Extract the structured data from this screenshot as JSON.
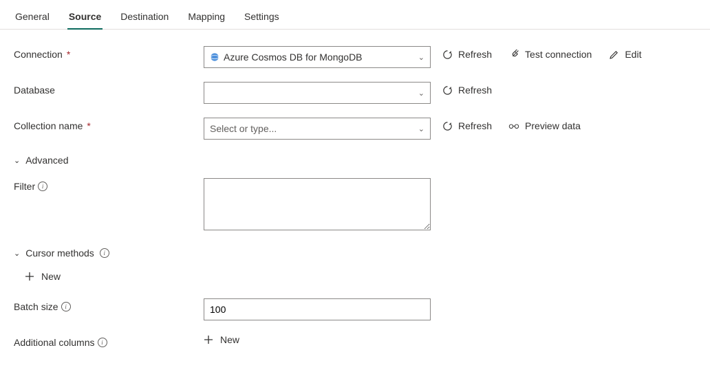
{
  "tabs": {
    "general": "General",
    "source": "Source",
    "destination": "Destination",
    "mapping": "Mapping",
    "settings": "Settings",
    "active": "source"
  },
  "labels": {
    "connection": "Connection",
    "database": "Database",
    "collection_name": "Collection name",
    "advanced": "Advanced",
    "filter": "Filter",
    "cursor_methods": "Cursor methods",
    "batch_size": "Batch size",
    "additional_columns": "Additional columns"
  },
  "fields": {
    "connection_value": "Azure Cosmos DB for MongoDB",
    "database_value": "",
    "collection_placeholder": "Select or type...",
    "filter_value": "",
    "batch_size_value": "100"
  },
  "actions": {
    "refresh": "Refresh",
    "test_connection": "Test connection",
    "edit": "Edit",
    "preview_data": "Preview data",
    "new": "New"
  }
}
